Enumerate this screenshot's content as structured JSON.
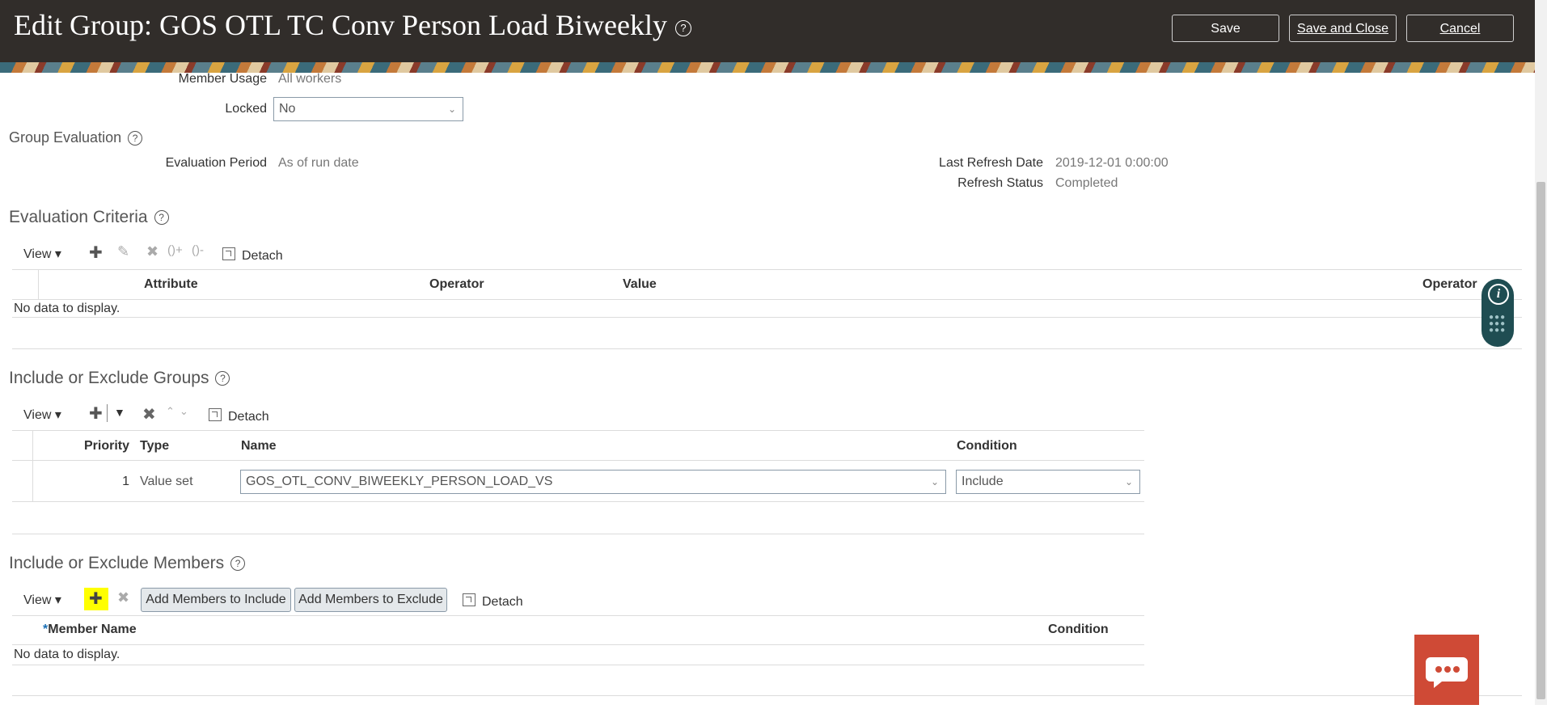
{
  "header": {
    "title": "Edit Group: GOS OTL TC Conv Person Load Biweekly",
    "help": "?",
    "save_label": "Save",
    "save_close_label": "Save and Close",
    "cancel_label": "Cancel"
  },
  "details": {
    "member_usage_label": "Member Usage",
    "member_usage_value": "All workers",
    "locked_label": "Locked",
    "locked_value": "No"
  },
  "group_evaluation": {
    "title": "Group Evaluation",
    "evaluation_period_label": "Evaluation Period",
    "evaluation_period_value": "As of run date",
    "last_refresh_label": "Last Refresh Date",
    "last_refresh_value": "2019-12-01 0:00:00",
    "refresh_status_label": "Refresh Status",
    "refresh_status_value": "Completed"
  },
  "evaluation_criteria": {
    "title": "Evaluation Criteria",
    "view_label": "View",
    "detach_label": "Detach",
    "columns": [
      "Attribute",
      "Operator",
      "Value",
      "Operator"
    ],
    "empty_text": "No data to display."
  },
  "include_exclude_groups": {
    "title": "Include or Exclude Groups",
    "view_label": "View",
    "detach_label": "Detach",
    "columns": {
      "priority": "Priority",
      "type": "Type",
      "name": "Name",
      "condition": "Condition"
    },
    "rows": [
      {
        "priority": "1",
        "type": "Value set",
        "name": "GOS_OTL_CONV_BIWEEKLY_PERSON_LOAD_VS",
        "condition": "Include"
      }
    ]
  },
  "include_exclude_members": {
    "title": "Include or Exclude Members",
    "view_label": "View",
    "add_include_label": "Add Members to Include",
    "add_exclude_label": "Add Members to Exclude",
    "detach_label": "Detach",
    "columns": {
      "required_marker": "*",
      "member_name": "Member Name",
      "condition": "Condition"
    },
    "empty_text": "No data to display."
  },
  "colors": {
    "header_bg": "#312d2a",
    "chat_bg": "#cf4a36",
    "info_bg": "#1f4d52",
    "highlight": "#ffff00"
  }
}
